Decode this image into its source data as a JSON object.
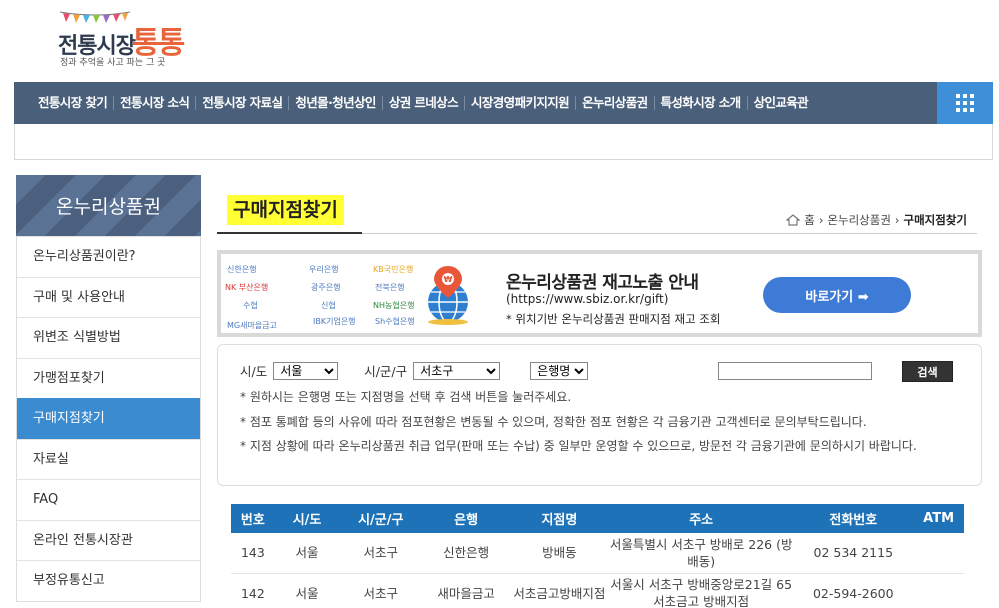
{
  "logo": {
    "title": "전통시장",
    "accent": "통통",
    "tagline": "정과 추억을 사고 파는 그 곳"
  },
  "gnb": {
    "items": [
      "전통시장 찾기",
      "전통시장 소식",
      "전통시장 자료실",
      "청년몰·청년상인",
      "상권 르네상스",
      "시장경영패키지지원",
      "온누리상품권",
      "특성화시장 소개",
      "상인교육관"
    ],
    "allmenu_icon": "grid-menu-icon"
  },
  "sidebar": {
    "title": "온누리상품권",
    "items": [
      "온누리상품권이란?",
      "구매 및 사용안내",
      "위변조 식별방법",
      "가맹점포찾기",
      "구매지점찾기",
      "자료실",
      "FAQ",
      "온라인 전통시장관",
      "부정유통신고"
    ],
    "active_index": 4
  },
  "page": {
    "title": "구매지점찾기",
    "breadcrumb": {
      "home": "홈",
      "level1": "온누리상품권",
      "current": "구매지점찾기"
    }
  },
  "banner": {
    "title": "온누리상품권 재고노출 안내",
    "url": "(https://www.sbiz.or.kr/gift)",
    "desc": "* 위치기반 온누리상품권 판매지점 재고 조회",
    "button": "바로가기 ➡",
    "banks": [
      "신한은행",
      "우리은행",
      "KB국민은행",
      "NK 부산은행",
      "광주은행",
      "전북은행",
      "수협",
      "신협",
      "NH농협은행",
      "MG새마을금고",
      "IBK기업은행",
      "Sh수협은행"
    ]
  },
  "search": {
    "sido_label": "시/도",
    "sido_value": "서울",
    "sigungu_label": "시/군/구",
    "sigungu_value": "서초구",
    "bank_value": "은행명",
    "keyword_value": "",
    "button": "검색",
    "notes": [
      "* 원하시는 은행명 또는 지점명을 선택 후 검색 버튼을 눌러주세요.",
      "* 점포 통폐합 등의 사유에 따라 점포현황은 변동될 수 있으며, 정확한 점포 현황은 각 금융기관 고객센터로 문의부탁드립니다.",
      "* 지점 상황에 따라 온누리상품권 취급 업무(판매 또는 수납) 중 일부만 운영할 수 있으므로, 방문전 각 금융기관에 문의하시기 바랍니다."
    ]
  },
  "table": {
    "headers": [
      "번호",
      "시/도",
      "시/군/구",
      "은행",
      "지점명",
      "주소",
      "전화번호",
      "ATM"
    ],
    "rows": [
      [
        "143",
        "서울",
        "서초구",
        "신한은행",
        "방배동",
        "서울특별시 서초구 방배로 226 (방배동)",
        "02 534 2115",
        ""
      ],
      [
        "142",
        "서울",
        "서초구",
        "새마을금고",
        "서초금고방배지점",
        "서울시 서초구 방배중앙로21길 65 서초금고 방배지점",
        "02-594-2600",
        ""
      ]
    ]
  },
  "colors": {
    "gnb_bg": "#4a5f7a",
    "accent_blue": "#3a8bd0",
    "title_highlight": "#ffff33",
    "table_header": "#1e73b8"
  }
}
